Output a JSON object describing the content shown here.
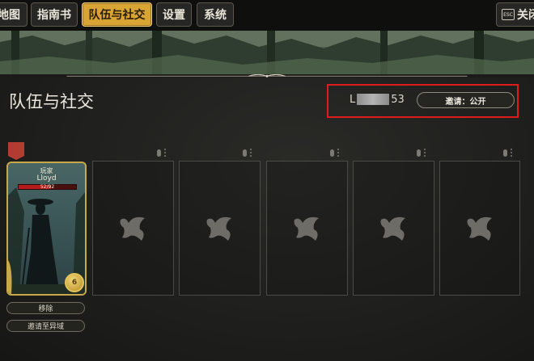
{
  "top_menu": {
    "tabs": [
      {
        "label": "地图"
      },
      {
        "label": "指南书"
      },
      {
        "label": "队伍与社交",
        "active": true
      },
      {
        "label": "设置"
      },
      {
        "label": "系统"
      }
    ],
    "close": {
      "key": "ESC",
      "label": "关闭"
    }
  },
  "page": {
    "title": "队伍与社交"
  },
  "session": {
    "prefix": "L",
    "suffix": "53",
    "invite_label": "邀请：公开"
  },
  "player": {
    "role": "玩家",
    "name": "Lloyd",
    "hp_text": "52/92",
    "hp_fraction": 0.565,
    "level": "6",
    "remove_label": "移除",
    "invite_world_label": "邀请至异域"
  },
  "empty_slots": [
    {
      "icon": "bird-silhouette-icon"
    },
    {
      "icon": "bird-silhouette-icon"
    },
    {
      "icon": "bird-silhouette-icon"
    },
    {
      "icon": "bird-silhouette-icon"
    },
    {
      "icon": "bird-silhouette-icon"
    }
  ],
  "colors": {
    "active_tab": "#d8a534",
    "highlight": "#e01b1b",
    "card_border": "#c8a94a",
    "hp": "#b41b1b"
  }
}
